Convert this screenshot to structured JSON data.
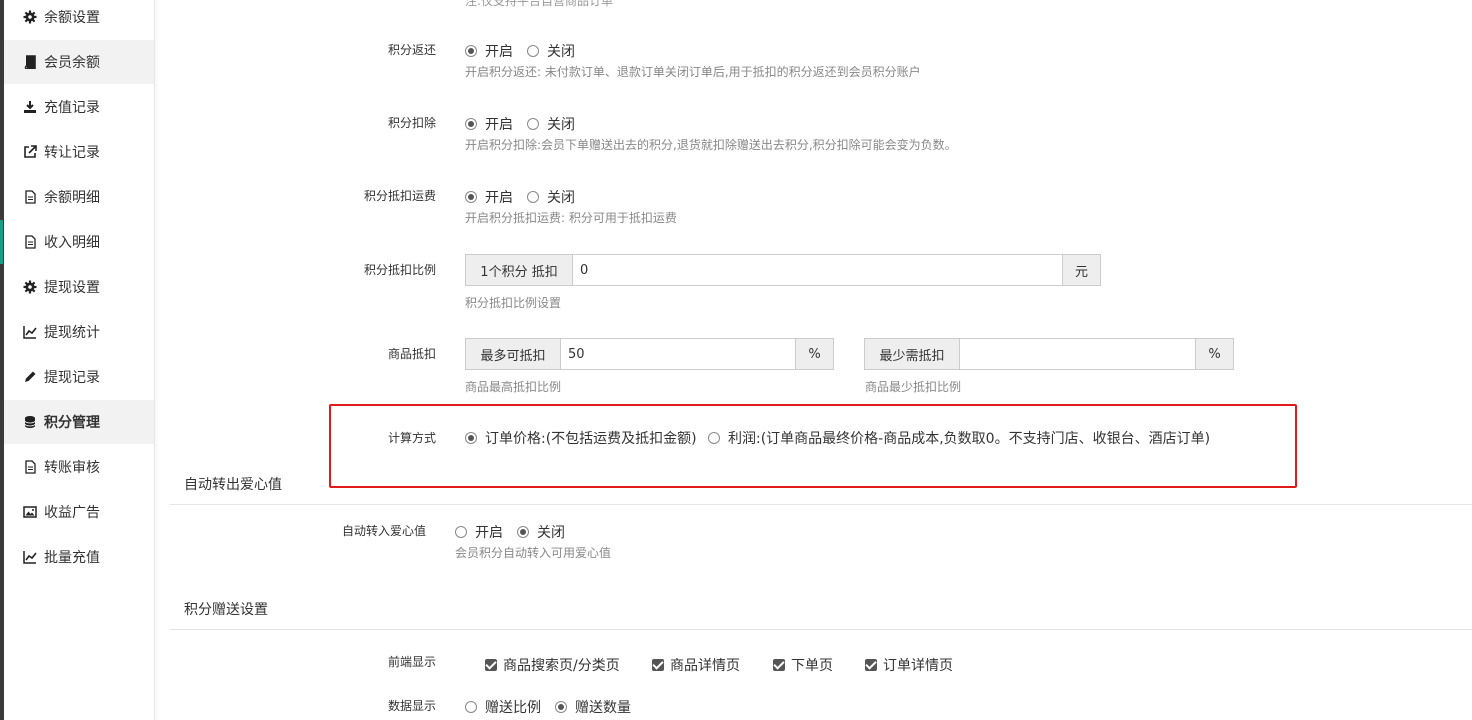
{
  "sidebar": {
    "items": [
      {
        "label": "余额设置",
        "icon": "gear-icon"
      },
      {
        "label": "会员余额",
        "icon": "book-icon"
      },
      {
        "label": "充值记录",
        "icon": "download-icon"
      },
      {
        "label": "转让记录",
        "icon": "external-link-icon"
      },
      {
        "label": "余额明细",
        "icon": "document-icon"
      },
      {
        "label": "收入明细",
        "icon": "document-icon"
      },
      {
        "label": "提现设置",
        "icon": "gear-icon"
      },
      {
        "label": "提现统计",
        "icon": "line-chart-icon"
      },
      {
        "label": "提现记录",
        "icon": "pencil-icon"
      },
      {
        "label": "积分管理",
        "icon": "database-icon"
      },
      {
        "label": "转账审核",
        "icon": "document-icon"
      },
      {
        "label": "收益广告",
        "icon": "image-icon"
      },
      {
        "label": "批量充值",
        "icon": "line-chart-icon"
      }
    ],
    "active_item": "积分管理"
  },
  "top_cut_hint": "注:仅支持平台自营商品订单",
  "form": {
    "points_return": {
      "label": "积分返还",
      "on": "开启",
      "off": "关闭",
      "selected": "on",
      "hint": "开启积分返还:  未付款订单、退款订单关闭订单后,用于抵扣的积分返还到会员积分账户"
    },
    "points_deduct": {
      "label": "积分扣除",
      "on": "开启",
      "off": "关闭",
      "selected": "on",
      "hint": "开启积分扣除:会员下单赠送出去的积分,退货就扣除赠送出去积分,积分扣除可能会变为负数。"
    },
    "points_shipping": {
      "label": "积分抵扣运费",
      "on": "开启",
      "off": "关闭",
      "selected": "on",
      "hint": "开启积分抵扣运费:  积分可用于抵扣运费"
    },
    "points_ratio": {
      "label": "积分抵扣比例",
      "prefix": "1个积分 抵扣",
      "value": "0",
      "suffix": "元",
      "hint": "积分抵扣比例设置"
    },
    "goods_deduct": {
      "label": "商品抵扣",
      "max_prefix": "最多可抵扣",
      "max_value": "50",
      "max_suffix": "%",
      "max_hint": "商品最高抵扣比例",
      "min_prefix": "最少需抵扣",
      "min_value": "",
      "min_suffix": "%",
      "min_hint": "商品最少抵扣比例"
    },
    "calc_method": {
      "label": "计算方式",
      "opt1": "订单价格:(不包括运费及抵扣金额)",
      "opt2": "利润:(订单商品最终价格-商品成本,负数取0。不支持门店、收银台、酒店订单)",
      "selected": "opt1"
    }
  },
  "section_love": {
    "title": "自动转出爱心值",
    "auto_transfer": {
      "label": "自动转入爱心值",
      "on": "开启",
      "off": "关闭",
      "selected": "off",
      "hint": "会员积分自动转入可用爱心值"
    }
  },
  "section_gift": {
    "title": "积分赠送设置",
    "frontend_display": {
      "label": "前端显示",
      "options": [
        "商品搜索页/分类页",
        "商品详情页",
        "下单页",
        "订单详情页"
      ]
    },
    "data_display": {
      "label": "数据显示",
      "opt1": "赠送比例",
      "opt2": "赠送数量",
      "selected": "opt2"
    }
  },
  "colors": {
    "accent": "#1a9d85",
    "highlight_border": "#e01b1b"
  }
}
